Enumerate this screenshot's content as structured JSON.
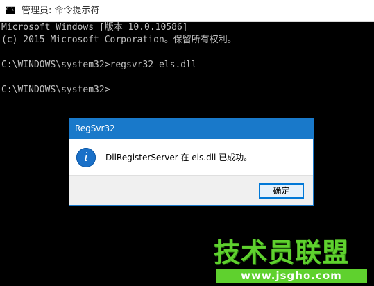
{
  "window": {
    "title": "管理员: 命令提示符",
    "icon_text": "C:\\."
  },
  "console": {
    "lines": [
      "Microsoft Windows [版本 10.0.10586]",
      "(c) 2015 Microsoft Corporation。保留所有权利。",
      "",
      "C:\\WINDOWS\\system32>regsvr32 els.dll",
      "",
      "C:\\WINDOWS\\system32>"
    ]
  },
  "dialog": {
    "title": "RegSvr32",
    "icon": "info-icon",
    "icon_glyph": "i",
    "message": "DllRegisterServer 在 els.dll 已成功。",
    "ok_label": "确定"
  },
  "watermark": {
    "text": "技术员联盟",
    "url": "www.jsgho.com"
  },
  "colors": {
    "console_bg": "#000000",
    "console_fg": "#c0c0c0",
    "dialog_accent": "#1979ca",
    "watermark": "#5fd12e"
  }
}
